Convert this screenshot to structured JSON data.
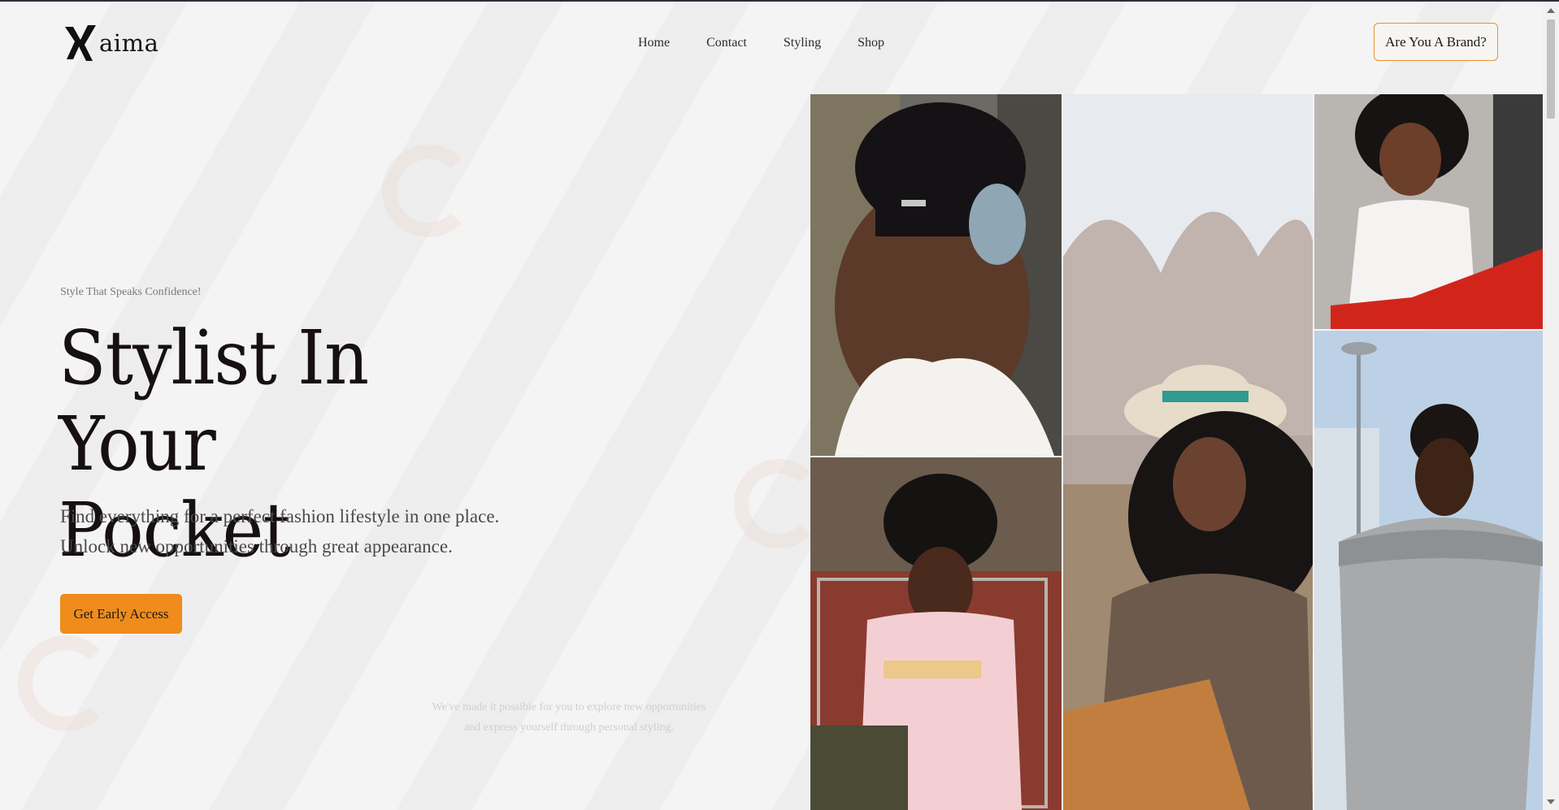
{
  "header": {
    "logo_text": "aima",
    "nav": [
      "Home",
      "Contact",
      "Styling",
      "Shop"
    ],
    "brand_button": "Are You A Brand?"
  },
  "hero": {
    "tagline": "Style That Speaks Confidence!",
    "headline_line1": "Stylist In Your",
    "headline_line2": "Pocket",
    "subtext": "Find everything for a perfect fashion lifestyle in one place. Unlock new opportunities through great appearance.",
    "cta": "Get Early Access",
    "faint_note": "We've made it possible for you to explore new opportunities and express yourself through personal styling."
  },
  "colors": {
    "accent": "#ef8c1b",
    "accent_border": "#e9912c",
    "page_bg": "#f4f4f4",
    "heading": "#160f14"
  },
  "gallery": {
    "photos": [
      "woman-beanie-headphones",
      "woman-in-shopping-cart",
      "woman-hat-plaid-blazer",
      "woman-white-top-red-pants",
      "woman-grey-off-shoulder-dress"
    ]
  }
}
